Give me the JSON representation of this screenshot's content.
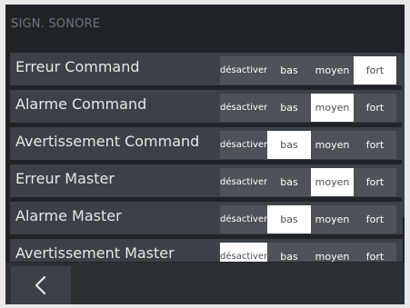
{
  "header": {
    "title": "SIGN. SONORE"
  },
  "options": [
    "désactiver",
    "bas",
    "moyen",
    "fort"
  ],
  "rows": [
    {
      "label": "Erreur Command",
      "selected": 3
    },
    {
      "label": "Alarme Command",
      "selected": 2
    },
    {
      "label": "Avertissement Command",
      "selected": 1
    },
    {
      "label": "Erreur Master",
      "selected": 2
    },
    {
      "label": "Alarme Master",
      "selected": 1
    },
    {
      "label": "Avertissement Master",
      "selected": 0
    }
  ],
  "icons": {
    "back": "chevron-left-icon"
  },
  "colors": {
    "background": "#202327",
    "row": "#3b4147",
    "segment": "#4e5359",
    "selected": "#ffffff"
  }
}
